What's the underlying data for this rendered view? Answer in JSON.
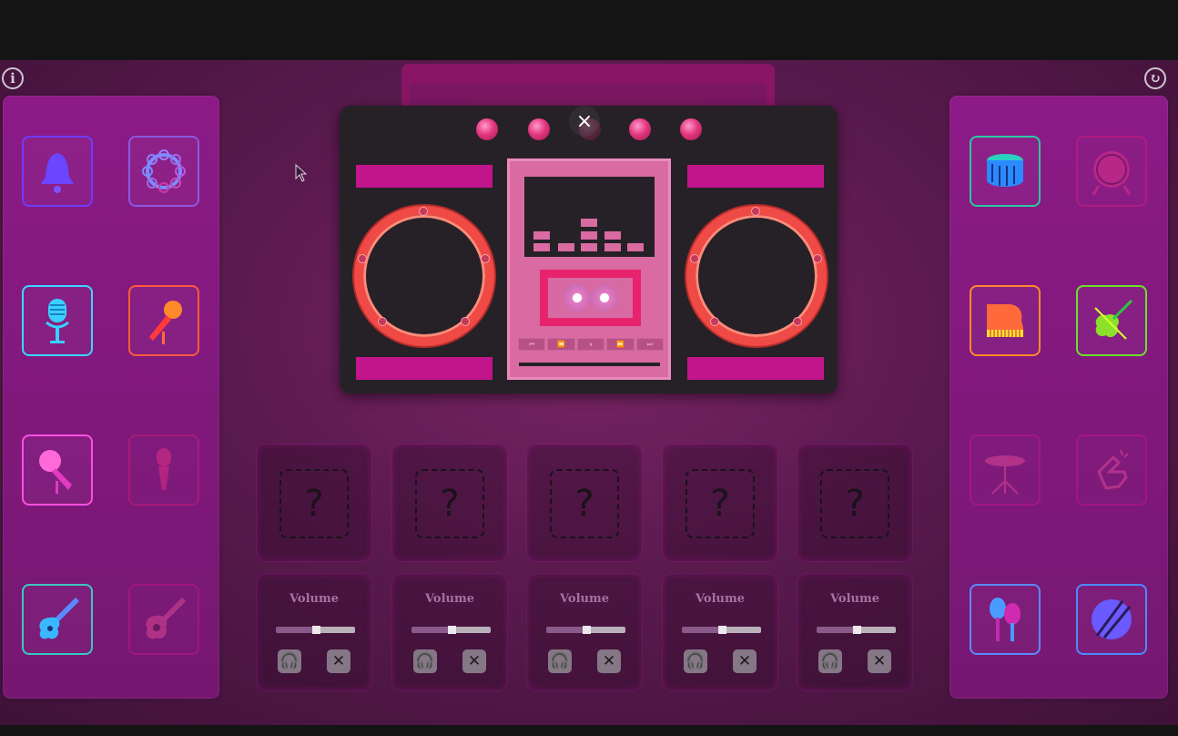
{
  "header": {
    "info_icon": "info-icon",
    "reset_icon": "refresh-icon"
  },
  "left_instruments": [
    {
      "name": "bell",
      "colors": [
        "#7a3cff",
        "#4a4bff"
      ]
    },
    {
      "name": "tambourine",
      "colors": [
        "#6d7cff",
        "#e12ea2"
      ]
    },
    {
      "name": "vintage-microphone",
      "colors": [
        "#38d8ff",
        "#1aa0ff"
      ]
    },
    {
      "name": "handheld-microphone",
      "colors": [
        "#ff4a3a",
        "#ff9a2a"
      ]
    },
    {
      "name": "pink-microphone",
      "colors": [
        "#ff4fe0",
        "#c32ab0"
      ]
    },
    {
      "name": "stick-microphone",
      "colors": [
        "#e22079",
        "#c01a6a"
      ]
    },
    {
      "name": "electric-guitar",
      "colors": [
        "#1ad0c0",
        "#8a48ff"
      ]
    },
    {
      "name": "acoustic-guitar",
      "colors": [
        "#b8178a",
        "#a0157a"
      ]
    }
  ],
  "right_instruments": [
    {
      "name": "snare-drum",
      "colors": [
        "#1ad0c0",
        "#2a7dff"
      ]
    },
    {
      "name": "bass-drum",
      "colors": [
        "#a0157a",
        "#c01a6a"
      ]
    },
    {
      "name": "grand-piano",
      "colors": [
        "#ff2a55",
        "#ffd02a"
      ]
    },
    {
      "name": "violin",
      "colors": [
        "#2ac840",
        "#d8ff2a"
      ]
    },
    {
      "name": "cymbal",
      "colors": [
        "#b8178a",
        "#a0157a"
      ]
    },
    {
      "name": "snapping-hand",
      "colors": [
        "#b8178a",
        "#a0157a"
      ]
    },
    {
      "name": "maracas",
      "colors": [
        "#3a9aff",
        "#d02ab0"
      ]
    },
    {
      "name": "drum-sticks",
      "colors": [
        "#5a7aff",
        "#c02ab0"
      ]
    }
  ],
  "boombox": {
    "close_label": "×",
    "transport": [
      "⏮",
      "⏪",
      "⏸",
      "⏩",
      "⏭"
    ]
  },
  "slots": [
    {
      "placeholder": "?",
      "volume_label": "Volume",
      "volume": 0.5,
      "mute_label": "✕"
    },
    {
      "placeholder": "?",
      "volume_label": "Volume",
      "volume": 0.5,
      "mute_label": "✕"
    },
    {
      "placeholder": "?",
      "volume_label": "Volume",
      "volume": 0.5,
      "mute_label": "✕"
    },
    {
      "placeholder": "?",
      "volume_label": "Volume",
      "volume": 0.5,
      "mute_label": "✕"
    },
    {
      "placeholder": "?",
      "volume_label": "Volume",
      "volume": 0.5,
      "mute_label": "✕"
    }
  ],
  "colors": {
    "accent": "#c2158c",
    "panel": "#8c1a87",
    "speaker": "#ef4a45"
  }
}
